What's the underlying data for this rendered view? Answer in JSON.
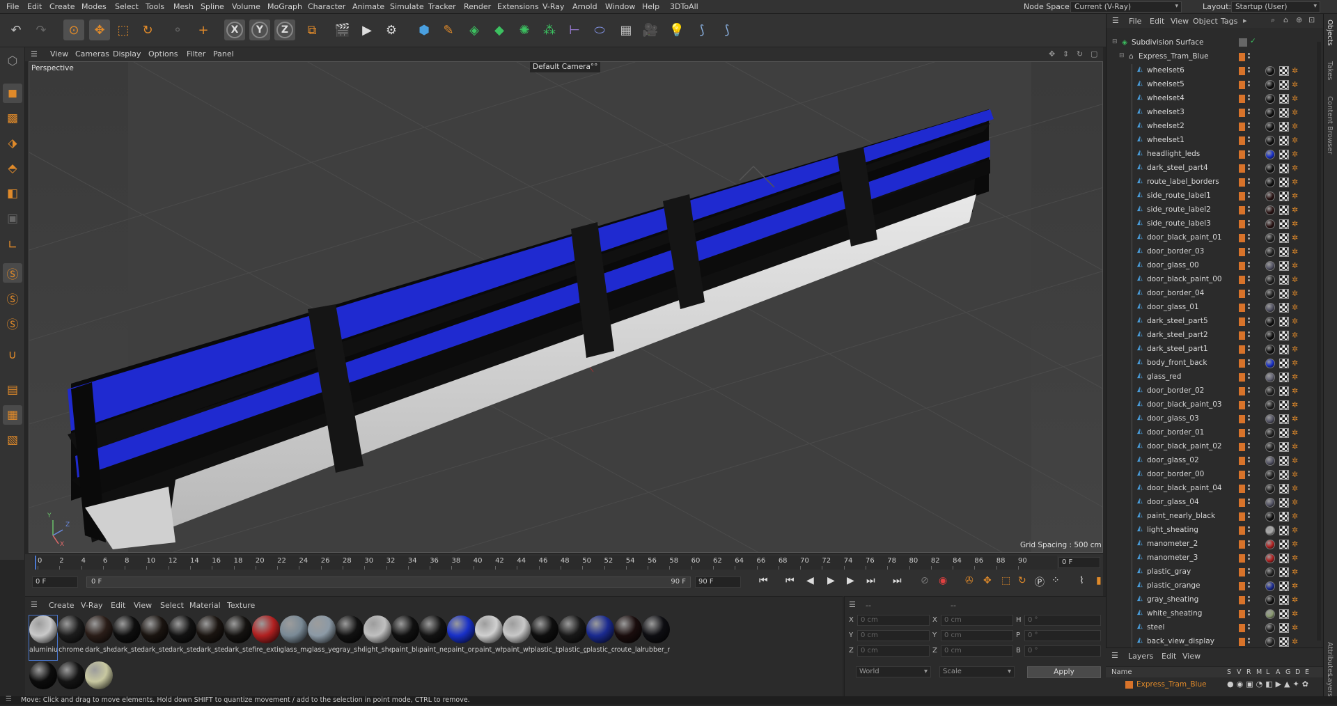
{
  "menubar": {
    "items": [
      "File",
      "Edit",
      "Create",
      "Modes",
      "Select",
      "Tools",
      "Mesh",
      "Spline",
      "Volume",
      "MoGraph",
      "Character",
      "Animate",
      "Simulate",
      "Tracker",
      "Render",
      "Extensions",
      "V-Ray",
      "Arnold",
      "Window",
      "Help",
      "3DToAll"
    ],
    "node_space_label": "Node Space:",
    "node_space_value": "Current (V-Ray)",
    "layout_label": "Layout:",
    "layout_value": "Startup (User)"
  },
  "viewport": {
    "menu": [
      "View",
      "Cameras",
      "Display",
      "Options",
      "Filter",
      "Panel"
    ],
    "view_name": "Perspective",
    "camera": "Default Camera",
    "camera_suffix": "°°",
    "grid_spacing": "Grid Spacing : 500 cm",
    "axis_labels": {
      "y": "Y",
      "z": "Z",
      "x": "X"
    }
  },
  "timeline": {
    "ticks": [
      "0",
      "2",
      "4",
      "6",
      "8",
      "10",
      "12",
      "14",
      "16",
      "18",
      "20",
      "22",
      "24",
      "26",
      "28",
      "30",
      "32",
      "34",
      "36",
      "38",
      "40",
      "42",
      "44",
      "46",
      "48",
      "50",
      "52",
      "54",
      "56",
      "58",
      "60",
      "62",
      "64",
      "66",
      "68",
      "70",
      "72",
      "74",
      "76",
      "78",
      "80",
      "82",
      "84",
      "86",
      "88",
      "90"
    ],
    "current_frame": "0 F",
    "start_field": "0 F",
    "range_start": "0 F",
    "range_end": "90 F",
    "end_field": "90 F",
    "current_frame_right": "0 F"
  },
  "materials": {
    "menu": [
      "Create",
      "V-Ray",
      "Edit",
      "View",
      "Select",
      "Material",
      "Texture"
    ],
    "items": [
      {
        "name": "aluminiu",
        "color": "#c9c9c9"
      },
      {
        "name": "chrome",
        "color": "#1c1c1c"
      },
      {
        "name": "dark_she",
        "color": "#2a1d18"
      },
      {
        "name": "dark_ste",
        "color": "#0e0e0e"
      },
      {
        "name": "dark_ste",
        "color": "#1a1410"
      },
      {
        "name": "dark_ste",
        "color": "#121212"
      },
      {
        "name": "dark_ste",
        "color": "#1a1410"
      },
      {
        "name": "dark_ste",
        "color": "#141210"
      },
      {
        "name": "fire_extir",
        "color": "#b02020"
      },
      {
        "name": "glass_ma",
        "color": "#7a8a96"
      },
      {
        "name": "glass_ye",
        "color": "#8c9aa6"
      },
      {
        "name": "gray_she",
        "color": "#111111"
      },
      {
        "name": "light_she",
        "color": "#c0c0c0"
      },
      {
        "name": "paint_bla",
        "color": "#101010"
      },
      {
        "name": "paint_ne",
        "color": "#121212"
      },
      {
        "name": "paint_or",
        "color": "#1830c8"
      },
      {
        "name": "paint_wh",
        "color": "#d0d0d0"
      },
      {
        "name": "paint_wh",
        "color": "#c8c8c8"
      },
      {
        "name": "plastic_b",
        "color": "#0e0e0e"
      },
      {
        "name": "plastic_g",
        "color": "#181818"
      },
      {
        "name": "plastic_o",
        "color": "#1a2a90"
      },
      {
        "name": "route_lal",
        "color": "#1a0d0d"
      },
      {
        "name": "rubber_r",
        "color": "#0e0e12"
      }
    ],
    "row2": [
      {
        "color": "#0c0c0c"
      },
      {
        "color": "#141414"
      },
      {
        "color": "#c8c8a0"
      }
    ]
  },
  "attributes": {
    "rows": [
      {
        "l1": "X",
        "v1": "0 cm",
        "l2": "X",
        "v2": "0 cm",
        "l3": "H",
        "v3": "0 °"
      },
      {
        "l1": "Y",
        "v1": "0 cm",
        "l2": "Y",
        "v2": "0 cm",
        "l3": "P",
        "v3": "0 °"
      },
      {
        "l1": "Z",
        "v1": "0 cm",
        "l2": "Z",
        "v2": "0 cm",
        "l3": "B",
        "v3": "0 °"
      }
    ],
    "coord_select": "World",
    "scale_select": "Scale",
    "apply": "Apply",
    "header_dashes": [
      "--",
      "--"
    ]
  },
  "objects": {
    "menu": [
      "File",
      "Edit",
      "View",
      "Object",
      "Tags"
    ],
    "root": "Subdivision Surface",
    "group": "Express_Tram_Blue",
    "items": [
      {
        "name": "wheelset6",
        "sph": "#111"
      },
      {
        "name": "wheelset5",
        "sph": "#111"
      },
      {
        "name": "wheelset4",
        "sph": "#111"
      },
      {
        "name": "wheelset3",
        "sph": "#111"
      },
      {
        "name": "wheelset2",
        "sph": "#111"
      },
      {
        "name": "wheelset1",
        "sph": "#111"
      },
      {
        "name": "headlight_leds",
        "sph": "#1830c8"
      },
      {
        "name": "dark_steel_part4",
        "sph": "#111"
      },
      {
        "name": "route_label_borders",
        "sph": "#111"
      },
      {
        "name": "side_route_label1",
        "sph": "#2a1414"
      },
      {
        "name": "side_route_label2",
        "sph": "#2a1414"
      },
      {
        "name": "side_route_label3",
        "sph": "#2a1414"
      },
      {
        "name": "door_black_paint_01",
        "sph": "#222"
      },
      {
        "name": "door_border_03",
        "sph": "#222"
      },
      {
        "name": "door_glass_00",
        "sph": "#556"
      },
      {
        "name": "door_black_paint_00",
        "sph": "#222"
      },
      {
        "name": "door_border_04",
        "sph": "#222"
      },
      {
        "name": "door_glass_01",
        "sph": "#556"
      },
      {
        "name": "dark_steel_part5",
        "sph": "#111"
      },
      {
        "name": "dark_steel_part2",
        "sph": "#111"
      },
      {
        "name": "dark_steel_part1",
        "sph": "#111"
      },
      {
        "name": "body_front_back",
        "sph": "#1830c8"
      },
      {
        "name": "glass_red",
        "sph": "#667"
      },
      {
        "name": "door_border_02",
        "sph": "#222"
      },
      {
        "name": "door_black_paint_03",
        "sph": "#222"
      },
      {
        "name": "door_glass_03",
        "sph": "#556"
      },
      {
        "name": "door_border_01",
        "sph": "#222"
      },
      {
        "name": "door_black_paint_02",
        "sph": "#222"
      },
      {
        "name": "door_glass_02",
        "sph": "#556"
      },
      {
        "name": "door_border_00",
        "sph": "#222"
      },
      {
        "name": "door_black_paint_04",
        "sph": "#222"
      },
      {
        "name": "door_glass_04",
        "sph": "#556"
      },
      {
        "name": "paint_nearly_black",
        "sph": "#111"
      },
      {
        "name": "light_sheating",
        "sph": "#aaa"
      },
      {
        "name": "manometer_2",
        "sph": "#b02020"
      },
      {
        "name": "manometer_3",
        "sph": "#b02020"
      },
      {
        "name": "plastic_gray",
        "sph": "#222"
      },
      {
        "name": "plastic_orange",
        "sph": "#1a2a90"
      },
      {
        "name": "gray_sheating",
        "sph": "#111"
      },
      {
        "name": "white_sheating",
        "sph": "#8a9a70"
      },
      {
        "name": "steel",
        "sph": "#222"
      },
      {
        "name": "back_view_display",
        "sph": "#222"
      }
    ]
  },
  "layers": {
    "menu": [
      "Layers",
      "Edit",
      "View"
    ],
    "col_name": "Name",
    "cols": [
      "S",
      "V",
      "R",
      "M",
      "L",
      "A",
      "G",
      "D",
      "E"
    ],
    "item": "Express_Tram_Blue"
  },
  "right_tabs": [
    "Objects",
    "Takes",
    "Content Browser",
    "Attributes",
    "Layers"
  ],
  "status": "Move: Click and drag to move elements. Hold down SHIFT to quantize movement / add to the selection in point mode, CTRL to remove."
}
